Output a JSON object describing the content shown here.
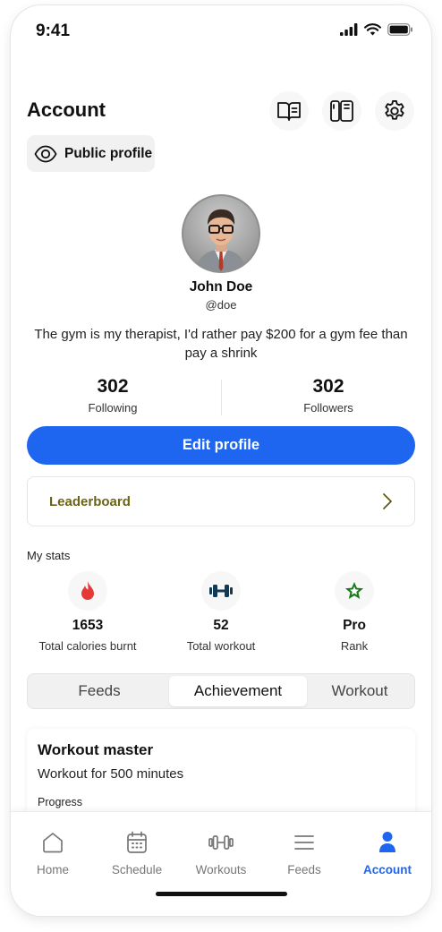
{
  "status_bar": {
    "time": "9:41"
  },
  "header": {
    "title": "Account"
  },
  "public_profile": {
    "label": "Public profile"
  },
  "profile": {
    "name": "John Doe",
    "handle": "@doe",
    "bio": "The gym is my therapist, I'd rather pay $200 for a gym fee than pay a shrink",
    "following_count": "302",
    "following_label": "Following",
    "followers_count": "302",
    "followers_label": "Followers"
  },
  "edit_profile_label": "Edit profile",
  "leaderboard_label": "Leaderboard",
  "my_stats": {
    "title": "My stats",
    "items": [
      {
        "value": "1653",
        "label": "Total calories burnt",
        "icon": "flame-icon",
        "color": "#e53935"
      },
      {
        "value": "52",
        "label": "Total workout",
        "icon": "dumbbell-icon",
        "color": "#123a55"
      },
      {
        "value": "Pro",
        "label": "Rank",
        "icon": "star-icon",
        "color": "#1b7a1b"
      }
    ]
  },
  "tabs": [
    {
      "label": "Feeds",
      "active": false
    },
    {
      "label": "Achievement",
      "active": true
    },
    {
      "label": "Workout",
      "active": false
    }
  ],
  "achievement": {
    "title": "Workout master",
    "description": "Workout for 500 minutes",
    "progress_label": "Progress"
  },
  "bottom_nav": [
    {
      "label": "Home",
      "icon": "home-icon",
      "active": false
    },
    {
      "label": "Schedule",
      "icon": "calendar-icon",
      "active": false
    },
    {
      "label": "Workouts",
      "icon": "dumbbell-icon",
      "active": false
    },
    {
      "label": "Feeds",
      "icon": "feed-lines-icon",
      "active": false
    },
    {
      "label": "Account",
      "icon": "user-icon",
      "active": true
    }
  ],
  "colors": {
    "accent": "#1e66f0",
    "leaderboard_text": "#6b6418"
  }
}
